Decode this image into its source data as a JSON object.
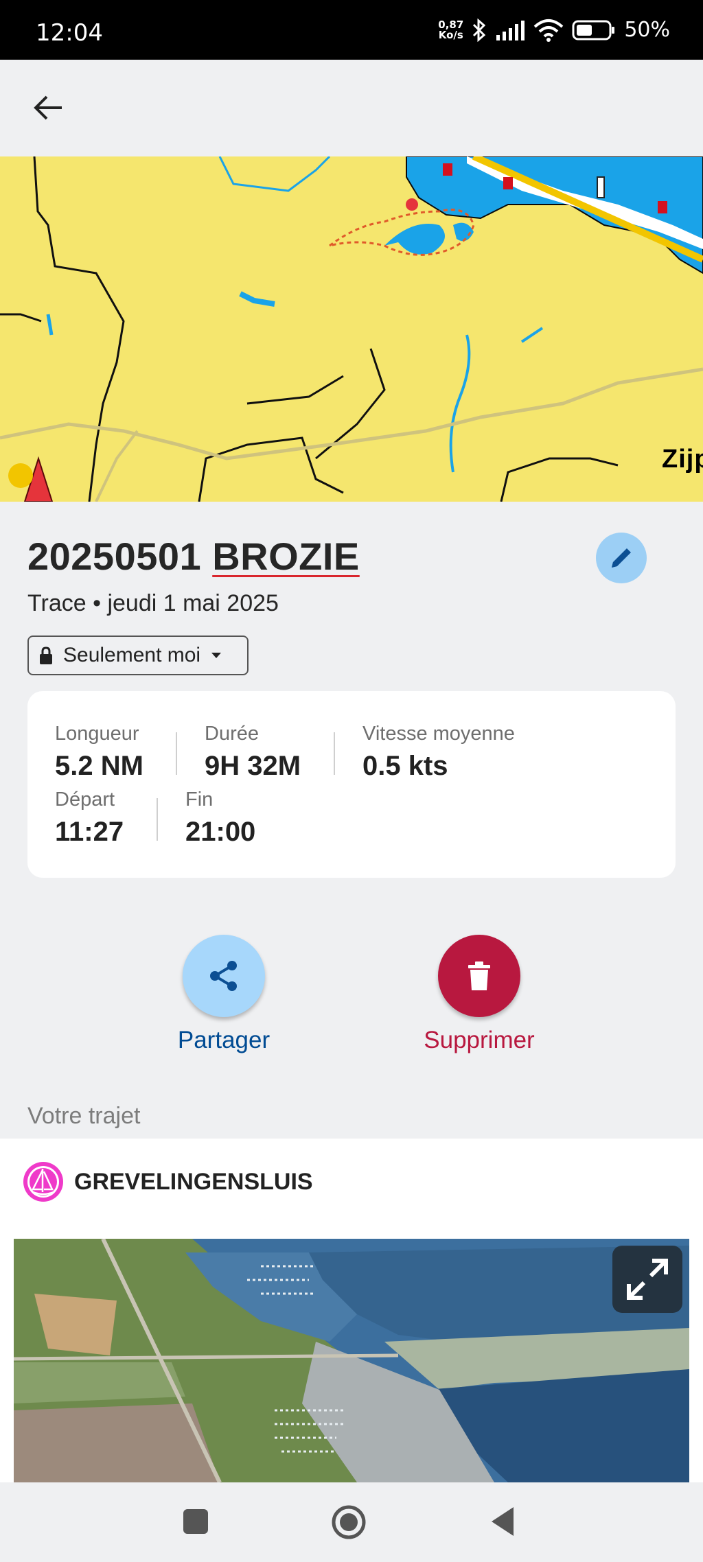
{
  "status_bar": {
    "time": "12:04",
    "speed_value": "0,87",
    "speed_unit": "Ko/s",
    "battery": "50%"
  },
  "map": {
    "place_label": "Zijp",
    "colors": {
      "land": "#f5e66e",
      "water": "#1aa3e8",
      "track": "#e05a2a"
    }
  },
  "track": {
    "title_part1": "20250501",
    "title_part2": "BROZIE",
    "subtitle": "Trace • jeudi 1 mai 2025",
    "privacy": "Seulement moi"
  },
  "stats": {
    "length_label": "Longueur",
    "length_value": "5.2 NM",
    "duration_label": "Durée",
    "duration_value": "9H 32M",
    "speed_label": "Vitesse moyenne",
    "speed_value": "0.5 kts",
    "start_label": "Départ",
    "start_value": "11:27",
    "end_label": "Fin",
    "end_value": "21:00"
  },
  "actions": {
    "share_label": "Partager",
    "delete_label": "Supprimer",
    "colors": {
      "share": "#004b93",
      "delete": "#b8183f",
      "share_bg": "#a7d7fb"
    }
  },
  "route": {
    "section_label": "Votre trajet",
    "poi_name": "GREVELINGENSLUIS"
  },
  "icons": [
    "back-arrow-icon",
    "edit-pencil-icon",
    "lock-icon",
    "dropdown-caret-icon",
    "share-icon",
    "trash-icon",
    "marina-icon",
    "expand-icon",
    "bluetooth-icon",
    "signal-icon",
    "wifi-icon",
    "battery-icon",
    "nav-square-icon",
    "nav-home-icon",
    "nav-back-icon"
  ]
}
